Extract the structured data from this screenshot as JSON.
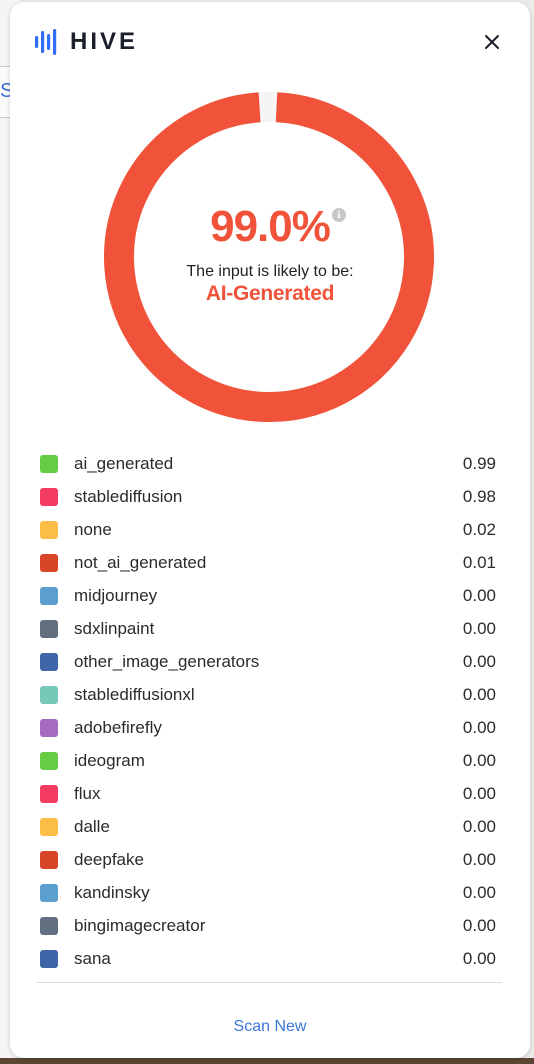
{
  "background": {
    "tab_fragment": "S"
  },
  "header": {
    "logo_text": "HIVE",
    "close_icon": "close-icon"
  },
  "result": {
    "percent_text": "99.0%",
    "percent_value": 0.99,
    "likely_text": "The input is likely to be:",
    "verdict": "AI-Generated",
    "accent_color": "#f0533a"
  },
  "legend": [
    {
      "label": "ai_generated",
      "value": "0.99",
      "color": "#66cc44"
    },
    {
      "label": "stablediffusion",
      "value": "0.98",
      "color": "#f43b62"
    },
    {
      "label": "none",
      "value": "0.02",
      "color": "#fbbd45"
    },
    {
      "label": "not_ai_generated",
      "value": "0.01",
      "color": "#d84527"
    },
    {
      "label": "midjourney",
      "value": "0.00",
      "color": "#5a9fcd"
    },
    {
      "label": "sdxlinpaint",
      "value": "0.00",
      "color": "#626f80"
    },
    {
      "label": "other_image_generators",
      "value": "0.00",
      "color": "#3f66a8"
    },
    {
      "label": "stablediffusionxl",
      "value": "0.00",
      "color": "#76c8b8"
    },
    {
      "label": "adobefirefly",
      "value": "0.00",
      "color": "#a56cc1"
    },
    {
      "label": "ideogram",
      "value": "0.00",
      "color": "#66cc44"
    },
    {
      "label": "flux",
      "value": "0.00",
      "color": "#f43b62"
    },
    {
      "label": "dalle",
      "value": "0.00",
      "color": "#fbbd45"
    },
    {
      "label": "deepfake",
      "value": "0.00",
      "color": "#d84527"
    },
    {
      "label": "kandinsky",
      "value": "0.00",
      "color": "#5a9fcd"
    },
    {
      "label": "bingimagecreator",
      "value": "0.00",
      "color": "#626f80"
    },
    {
      "label": "sana",
      "value": "0.00",
      "color": "#3f66a8"
    }
  ],
  "footer": {
    "scan_new_label": "Scan New",
    "link_color": "#3b78d8"
  }
}
